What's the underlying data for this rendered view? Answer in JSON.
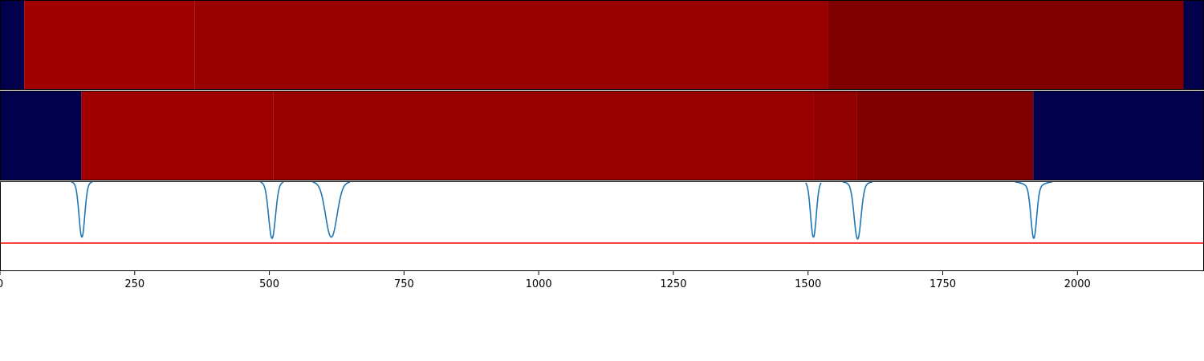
{
  "chart_data": {
    "type": "heatmap",
    "title": "",
    "xlabel": "",
    "ylabel": "",
    "xlim": [
      0,
      2235
    ],
    "grid": false,
    "x_ticks": [
      {
        "value": 0,
        "label": "0"
      },
      {
        "value": 250,
        "label": "250"
      },
      {
        "value": 500,
        "label": "500"
      },
      {
        "value": 750,
        "label": "750"
      },
      {
        "value": 1000,
        "label": "1000"
      },
      {
        "value": 1250,
        "label": "1250"
      },
      {
        "value": 1500,
        "label": "1500"
      },
      {
        "value": 1750,
        "label": "1750"
      },
      {
        "value": 2000,
        "label": "2000"
      }
    ],
    "segment_rows": [
      {
        "segments": [
          {
            "start": 0,
            "end": 45,
            "color": "#00004c"
          },
          {
            "start": 45,
            "end": 361,
            "color": "#a00000"
          },
          {
            "start": 361,
            "end": 1537,
            "color": "#980000"
          },
          {
            "start": 1537,
            "end": 2197,
            "color": "#800000"
          },
          {
            "start": 2197,
            "end": 2235,
            "color": "#00004c"
          }
        ]
      },
      {
        "segments": [
          {
            "start": 0,
            "end": 151,
            "color": "#00004c"
          },
          {
            "start": 151,
            "end": 507,
            "color": "#a00000"
          },
          {
            "start": 507,
            "end": 1510,
            "color": "#980000"
          },
          {
            "start": 1510,
            "end": 1590,
            "color": "#900000"
          },
          {
            "start": 1590,
            "end": 1918,
            "color": "#800000"
          },
          {
            "start": 1918,
            "end": 2235,
            "color": "#00004c"
          }
        ]
      }
    ],
    "signal": {
      "color": "#1f77b4",
      "ylim": [
        -1.0,
        0.0
      ],
      "baseline": 0.0,
      "dips": [
        {
          "center": 152,
          "depth": 0.9,
          "width": 5,
          "tail": 20
        },
        {
          "center": 505,
          "depth": 0.92,
          "width": 6,
          "tail": 22
        },
        {
          "center": 615,
          "depth": 0.9,
          "width": 10,
          "tail": 35
        },
        {
          "center": 1510,
          "depth": 0.9,
          "width": 5,
          "tail": 15
        },
        {
          "center": 1592,
          "depth": 0.93,
          "width": 6,
          "tail": 28
        },
        {
          "center": 1919,
          "depth": 0.92,
          "width": 5,
          "tail": 35
        }
      ],
      "threshold": {
        "value": -1.37,
        "color": "#ff0000"
      }
    }
  }
}
